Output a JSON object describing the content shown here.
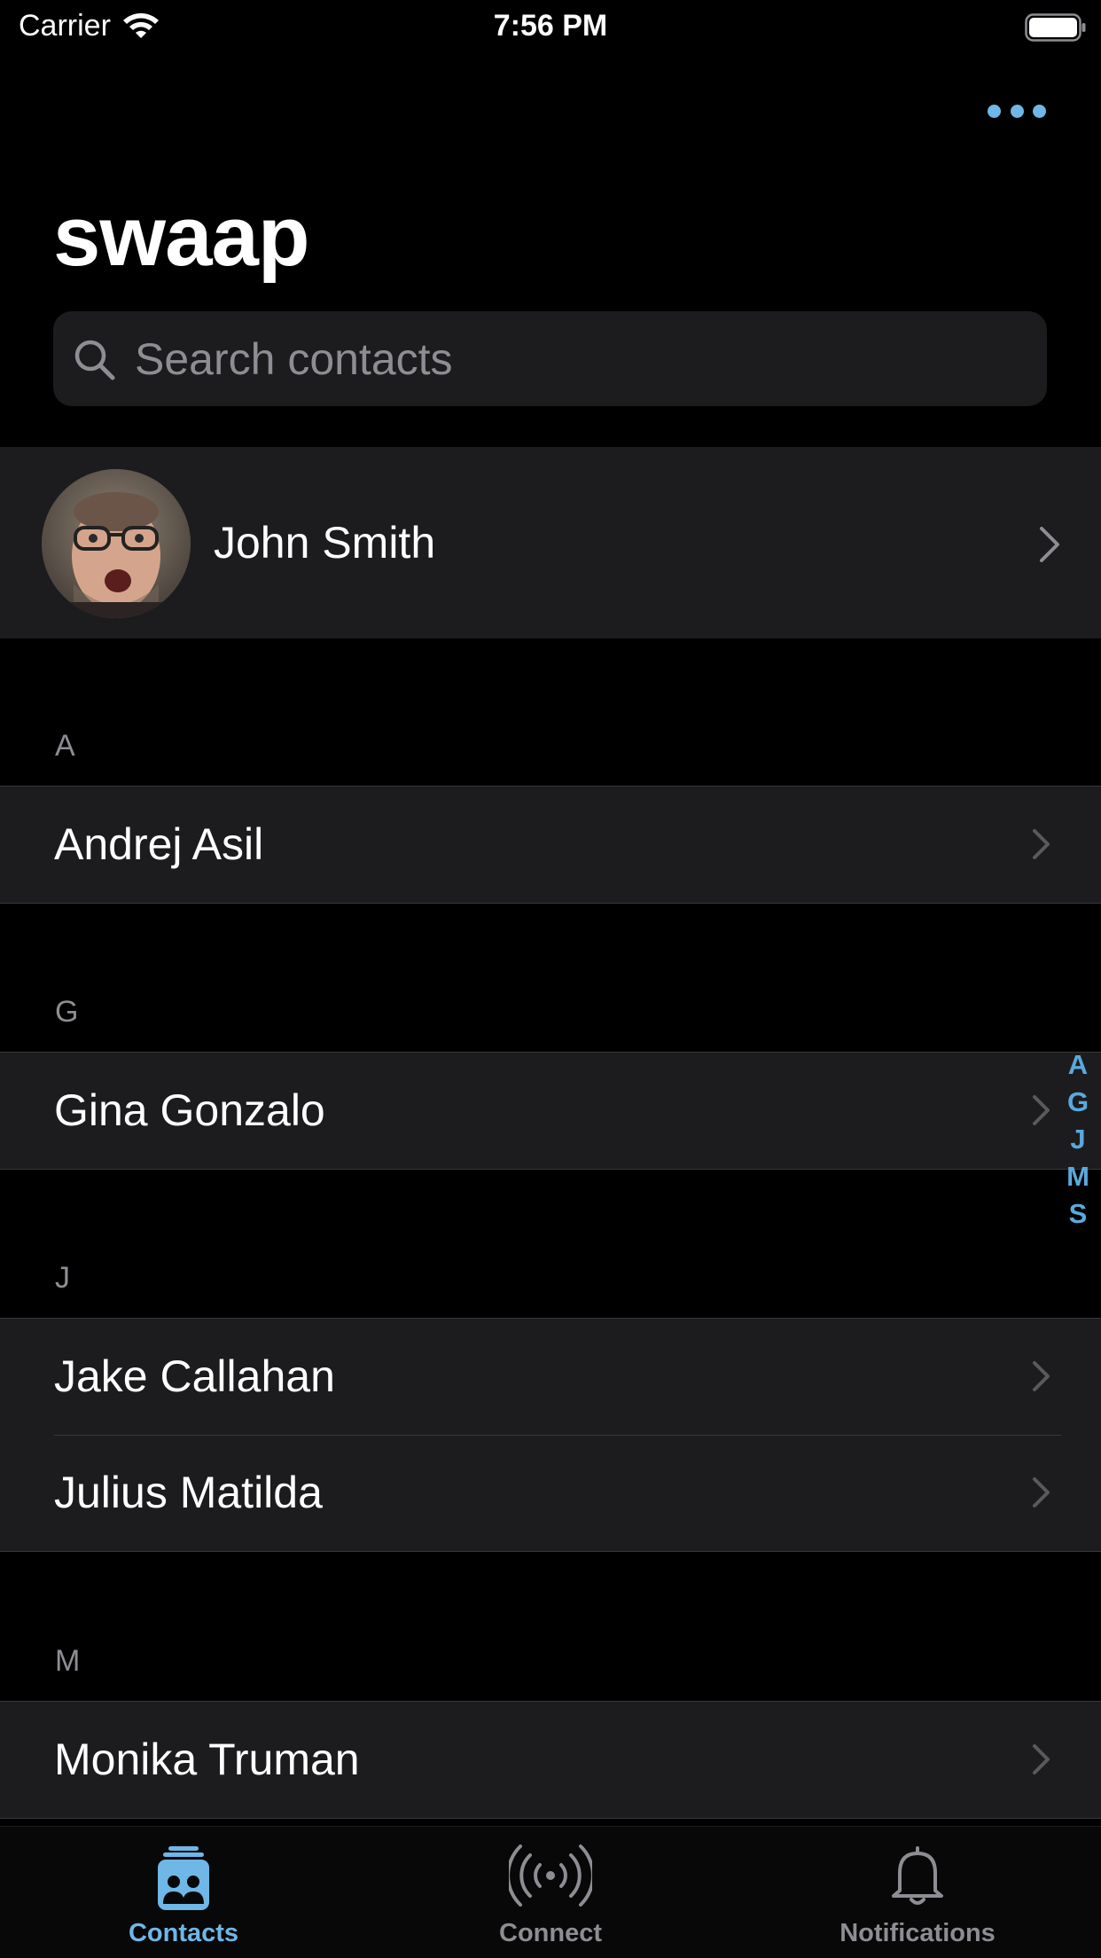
{
  "status_bar": {
    "carrier": "Carrier",
    "time": "7:56 PM"
  },
  "header": {
    "title": "swaap",
    "more_icon": "ellipsis-icon"
  },
  "search": {
    "placeholder": "Search contacts",
    "value": ""
  },
  "my_card": {
    "name": "John Smith"
  },
  "sections": [
    {
      "letter": "A",
      "contacts": [
        "Andrej Asil"
      ]
    },
    {
      "letter": "G",
      "contacts": [
        "Gina Gonzalo"
      ]
    },
    {
      "letter": "J",
      "contacts": [
        "Jake Callahan",
        "Julius Matilda"
      ]
    },
    {
      "letter": "M",
      "contacts": [
        "Monika Truman"
      ]
    }
  ],
  "index": [
    "A",
    "G",
    "J",
    "M",
    "S"
  ],
  "tabs": [
    {
      "label": "Contacts",
      "icon": "contacts-icon",
      "active": true
    },
    {
      "label": "Connect",
      "icon": "broadcast-icon",
      "active": false
    },
    {
      "label": "Notifications",
      "icon": "bell-icon",
      "active": false
    }
  ],
  "colors": {
    "accent": "#6fb7e6",
    "background": "#000000",
    "cell": "#1c1c1e",
    "secondary_text": "#8d8d93"
  }
}
